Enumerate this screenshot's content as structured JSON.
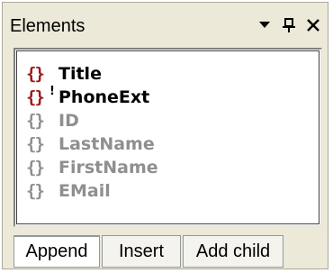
{
  "panel": {
    "title": "Elements"
  },
  "titlebar_buttons": [
    {
      "name": "dropdown-icon"
    },
    {
      "name": "pin-icon"
    },
    {
      "name": "close-icon"
    }
  ],
  "items": [
    {
      "icon": "{}",
      "label": "Title",
      "state": "active",
      "marker": ""
    },
    {
      "icon": "{}",
      "label": "PhoneExt",
      "state": "active",
      "marker": "!"
    },
    {
      "icon": "{}",
      "label": "ID",
      "state": "inactive",
      "marker": ""
    },
    {
      "icon": "{}",
      "label": "LastName",
      "state": "inactive",
      "marker": ""
    },
    {
      "icon": "{}",
      "label": "FirstName",
      "state": "inactive",
      "marker": ""
    },
    {
      "icon": "{}",
      "label": "EMail",
      "state": "inactive",
      "marker": ""
    }
  ],
  "tabs": [
    {
      "label": "Append",
      "selected": true
    },
    {
      "label": "Insert",
      "selected": false
    },
    {
      "label": "Add child",
      "selected": false
    }
  ],
  "colors": {
    "active_icon": "#9b1b1b",
    "inactive": "#8f8f8f",
    "panel_bg": "#ece9d8"
  }
}
